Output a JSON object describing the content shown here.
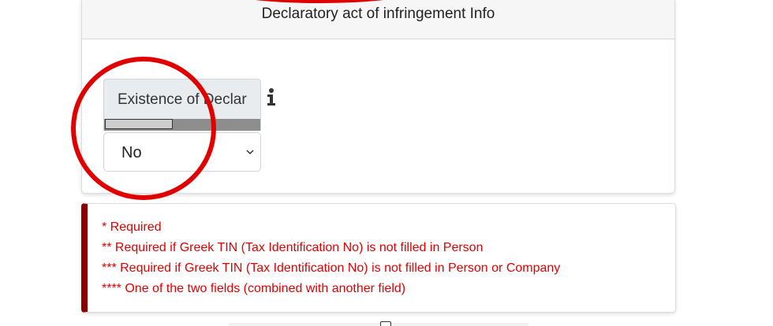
{
  "card": {
    "title": "Declaratory act of infringement Info"
  },
  "field": {
    "label": "Existence of Declar",
    "info_icon": "info-icon",
    "select_value": "No",
    "select_icon": "chevron-down-icon"
  },
  "notes": {
    "lines": [
      "* Required",
      "** Required if Greek TIN (Tax Identification No) is not filled in Person",
      "*** Required if Greek TIN (Tax Identification No) is not filled in Person or Company",
      "**** One of the two fields (combined with another field)"
    ]
  },
  "colors": {
    "annotation": "#e10000",
    "note_text": "#e00000",
    "note_accent": "#8b0000"
  }
}
